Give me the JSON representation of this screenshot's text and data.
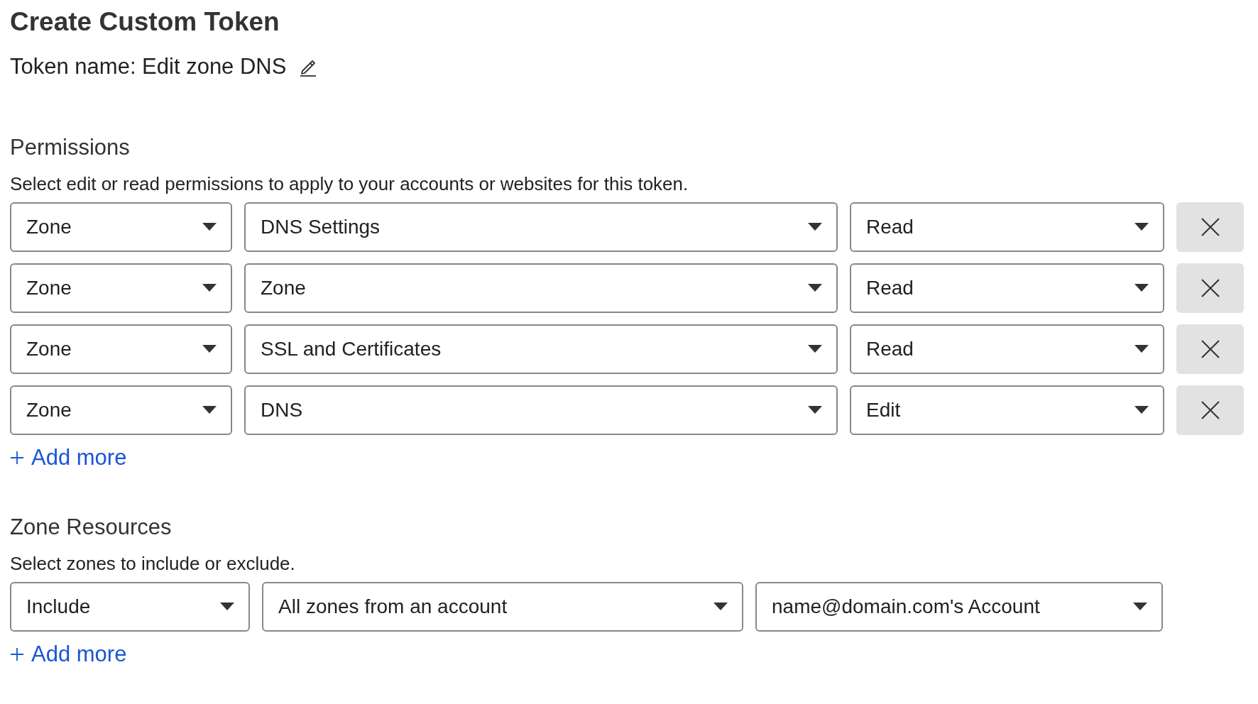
{
  "title": "Create Custom Token",
  "token_name": {
    "text": "Token name: Edit zone DNS"
  },
  "permissions": {
    "heading": "Permissions",
    "description": "Select edit or read permissions to apply to your accounts or websites for this token.",
    "rows": [
      {
        "scope": "Zone",
        "resource": "DNS Settings",
        "access": "Read"
      },
      {
        "scope": "Zone",
        "resource": "Zone",
        "access": "Read"
      },
      {
        "scope": "Zone",
        "resource": "SSL and Certificates",
        "access": "Read"
      },
      {
        "scope": "Zone",
        "resource": "DNS",
        "access": "Edit"
      }
    ],
    "add_more": "Add more"
  },
  "zone_resources": {
    "heading": "Zone Resources",
    "description": "Select zones to include or exclude.",
    "rows": [
      {
        "mode": "Include",
        "scope": "All zones from an account",
        "account": "name@domain.com's Account"
      }
    ],
    "add_more": "Add more"
  }
}
